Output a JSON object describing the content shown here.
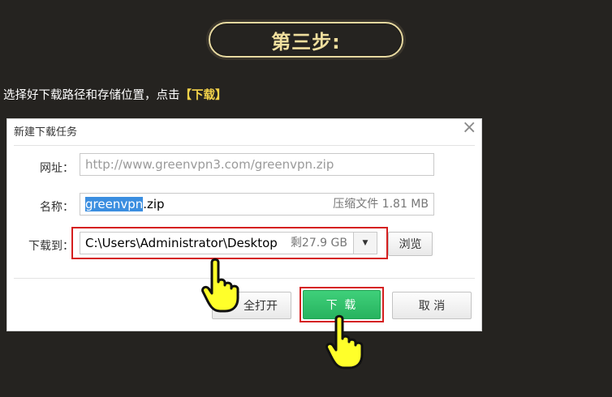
{
  "step": {
    "title": "第三步:"
  },
  "instruction": {
    "text": "选择好下载路径和存储位置，点击",
    "highlight": "【下载】"
  },
  "dialog": {
    "title": "新建下载任务",
    "url": {
      "label": "网址：",
      "value": "http://www.greenvpn3.com/greenvpn.zip"
    },
    "name": {
      "label": "名称：",
      "selected": "greenvpn",
      "rest": ".zip",
      "info": "压缩文件 1.81 MB"
    },
    "save_to": {
      "label": "下载到：",
      "path": "C:\\Users\\Administrator\\Desktop",
      "free_space": "剩27.9 GB"
    },
    "buttons": {
      "browse": "浏览",
      "open_all": "全打开",
      "download": "下 载",
      "cancel": "取 消"
    }
  },
  "colors": {
    "background": "#252320",
    "accent_gold": "#f0df9e",
    "highlight_yellow": "#f4d34a",
    "download_green": "#2fbf68",
    "callout_red": "#d51f1f"
  }
}
